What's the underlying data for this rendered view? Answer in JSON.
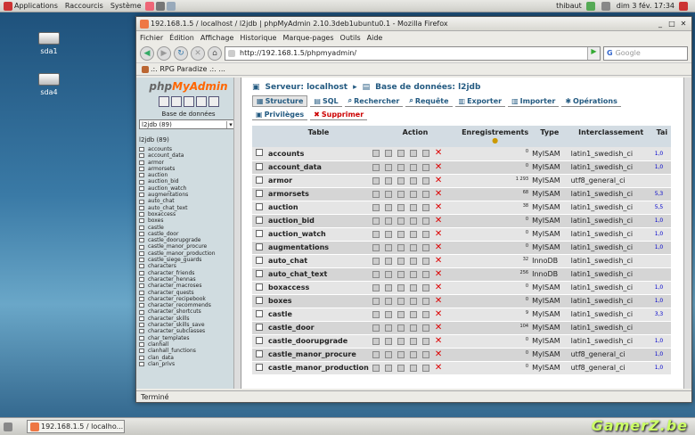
{
  "top_panel": {
    "menus": [
      "Applications",
      "Raccourcis",
      "Système"
    ],
    "user": "thibaut",
    "datetime": "dim  3 fév. 17:34"
  },
  "desktop_icons": [
    "sda1",
    "sda4"
  ],
  "window": {
    "title": "192.168.1.5 / localhost / l2jdb | phpMyAdmin 2.10.3deb1ubuntu0.1 - Mozilla Firefox",
    "menu": [
      "Fichier",
      "Édition",
      "Affichage",
      "Historique",
      "Marque-pages",
      "Outils",
      "Aide"
    ],
    "url": "http://192.168.1.5/phpmyadmin/",
    "search_placeholder": "Google",
    "bookmark": ".:. RPG Paradize .:. ...",
    "status": "Terminé"
  },
  "left": {
    "logo_php": "php",
    "logo_admin": "MyAdmin",
    "db_label": "Base de données",
    "db_selected": "l2jdb (89)",
    "db_title": "l2jdb (89)",
    "tables": [
      "accounts",
      "account_data",
      "armor",
      "armorsets",
      "auction",
      "auction_bid",
      "auction_watch",
      "augmentations",
      "auto_chat",
      "auto_chat_text",
      "boxaccess",
      "boxes",
      "castle",
      "castle_door",
      "castle_doorupgrade",
      "castle_manor_procure",
      "castle_manor_production",
      "castle_siege_guards",
      "characters",
      "character_friends",
      "character_hennas",
      "character_macroses",
      "character_quests",
      "character_recipebook",
      "character_recommends",
      "character_shortcuts",
      "character_skills",
      "character_skills_save",
      "character_subclasses",
      "char_templates",
      "clanhall",
      "clanhall_functions",
      "clan_data",
      "clan_privs"
    ]
  },
  "right": {
    "server": "Serveur: localhost",
    "database": "Base de données: l2jdb",
    "tabs": [
      "Structure",
      "SQL",
      "Rechercher",
      "Requête",
      "Exporter",
      "Importer",
      "Opérations",
      "Privilèges",
      "Supprimer"
    ],
    "headers": [
      "Table",
      "Action",
      "Enregistrements",
      "Type",
      "Interclassement",
      "Tai"
    ],
    "rows": [
      {
        "name": "accounts",
        "records": "0",
        "type": "MyISAM",
        "collation": "latin1_swedish_ci",
        "size": "1,0"
      },
      {
        "name": "account_data",
        "records": "0",
        "type": "MyISAM",
        "collation": "latin1_swedish_ci",
        "size": "1,0"
      },
      {
        "name": "armor",
        "records": "1 293",
        "type": "MyISAM",
        "collation": "utf8_general_ci",
        "size": ""
      },
      {
        "name": "armorsets",
        "records": "68",
        "type": "MyISAM",
        "collation": "latin1_swedish_ci",
        "size": "5,3"
      },
      {
        "name": "auction",
        "records": "38",
        "type": "MyISAM",
        "collation": "latin1_swedish_ci",
        "size": "5,5"
      },
      {
        "name": "auction_bid",
        "records": "0",
        "type": "MyISAM",
        "collation": "latin1_swedish_ci",
        "size": "1,0"
      },
      {
        "name": "auction_watch",
        "records": "0",
        "type": "MyISAM",
        "collation": "latin1_swedish_ci",
        "size": "1,0"
      },
      {
        "name": "augmentations",
        "records": "0",
        "type": "MyISAM",
        "collation": "latin1_swedish_ci",
        "size": "1,0"
      },
      {
        "name": "auto_chat",
        "records": "32",
        "type": "InnoDB",
        "collation": "latin1_swedish_ci",
        "size": ""
      },
      {
        "name": "auto_chat_text",
        "records": "256",
        "type": "InnoDB",
        "collation": "latin1_swedish_ci",
        "size": ""
      },
      {
        "name": "boxaccess",
        "records": "0",
        "type": "MyISAM",
        "collation": "latin1_swedish_ci",
        "size": "1,0"
      },
      {
        "name": "boxes",
        "records": "0",
        "type": "MyISAM",
        "collation": "latin1_swedish_ci",
        "size": "1,0"
      },
      {
        "name": "castle",
        "records": "9",
        "type": "MyISAM",
        "collation": "latin1_swedish_ci",
        "size": "3,3"
      },
      {
        "name": "castle_door",
        "records": "104",
        "type": "MyISAM",
        "collation": "latin1_swedish_ci",
        "size": ""
      },
      {
        "name": "castle_doorupgrade",
        "records": "0",
        "type": "MyISAM",
        "collation": "latin1_swedish_ci",
        "size": "1,0"
      },
      {
        "name": "castle_manor_procure",
        "records": "0",
        "type": "MyISAM",
        "collation": "utf8_general_ci",
        "size": "1,0"
      },
      {
        "name": "castle_manor_production",
        "records": "0",
        "type": "MyISAM",
        "collation": "utf8_general_ci",
        "size": "1,0"
      }
    ]
  },
  "taskbar": {
    "item": "192.168.1.5 / localho..."
  },
  "watermark": "GamerZ.be"
}
